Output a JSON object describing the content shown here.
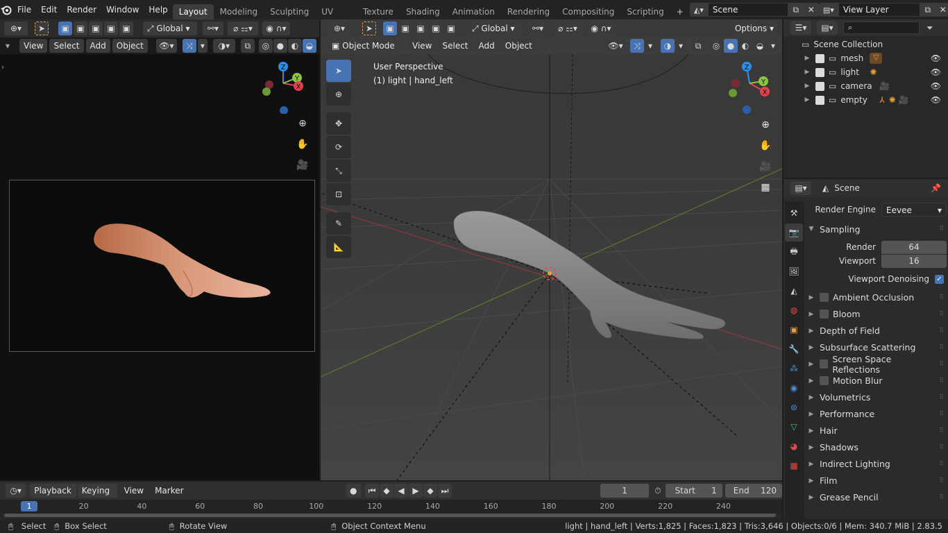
{
  "topbar": {
    "menus": [
      "File",
      "Edit",
      "Render",
      "Window",
      "Help"
    ],
    "workspaces": [
      "Layout",
      "Modeling",
      "Sculpting",
      "UV Editing",
      "Texture Paint",
      "Shading",
      "Animation",
      "Rendering",
      "Compositing",
      "Scripting"
    ],
    "active_workspace": "Layout",
    "add_tab": "+",
    "scene_name": "Scene",
    "view_layer": "View Layer"
  },
  "left_view": {
    "menus": [
      "View",
      "Select",
      "Add",
      "Object"
    ],
    "orientation": "Global"
  },
  "main_view": {
    "orientation": "Global",
    "options_label": "Options",
    "mode": "Object Mode",
    "menus": [
      "View",
      "Select",
      "Add",
      "Object"
    ],
    "overlay_title": "User Perspective",
    "overlay_subtitle": "(1) light | hand_left"
  },
  "gizmo": {
    "z": "Z",
    "y": "Y",
    "x": "X"
  },
  "outliner": {
    "root": "Scene Collection",
    "items": [
      {
        "name": "mesh"
      },
      {
        "name": "light"
      },
      {
        "name": "camera"
      },
      {
        "name": "empty"
      }
    ]
  },
  "properties": {
    "context": "Scene",
    "render_engine_label": "Render Engine",
    "render_engine_value": "Eevee",
    "sampling_label": "Sampling",
    "render_label": "Render",
    "render_value": "64",
    "viewport_label": "Viewport",
    "viewport_value": "16",
    "denoise_label": "Viewport Denoising",
    "panels": [
      {
        "label": "Ambient Occlusion",
        "checkbox": true
      },
      {
        "label": "Bloom",
        "checkbox": true
      },
      {
        "label": "Depth of Field",
        "checkbox": false
      },
      {
        "label": "Subsurface Scattering",
        "checkbox": false
      },
      {
        "label": "Screen Space Reflections",
        "checkbox": true
      },
      {
        "label": "Motion Blur",
        "checkbox": true
      },
      {
        "label": "Volumetrics",
        "checkbox": false
      },
      {
        "label": "Performance",
        "checkbox": false
      },
      {
        "label": "Hair",
        "checkbox": false
      },
      {
        "label": "Shadows",
        "checkbox": false
      },
      {
        "label": "Indirect Lighting",
        "checkbox": false
      },
      {
        "label": "Film",
        "checkbox": false
      },
      {
        "label": "Grease Pencil",
        "checkbox": false
      }
    ]
  },
  "timeline": {
    "menus": [
      "Playback",
      "Keying",
      "View",
      "Marker"
    ],
    "current_frame": "1",
    "start_label": "Start",
    "start_value": "1",
    "end_label": "End",
    "end_value": "120",
    "ticks": [
      "1",
      "20",
      "40",
      "60",
      "80",
      "100",
      "120",
      "140",
      "160",
      "180",
      "200",
      "220",
      "240"
    ]
  },
  "statusbar": {
    "select": "Select",
    "box_select": "Box Select",
    "rotate": "Rotate View",
    "context_menu": "Object Context Menu",
    "stats": "light | hand_left | Verts:1,825 | Faces:1,823 | Tris:3,646 | Objects:0/6 | Mem: 340.7 MiB | 2.83.5"
  },
  "colors": {
    "accent": "#4772b3",
    "x_axis": "#e2434e",
    "y_axis": "#8bc43f",
    "z_axis": "#2c8fea",
    "orange": "#e5a13a"
  }
}
